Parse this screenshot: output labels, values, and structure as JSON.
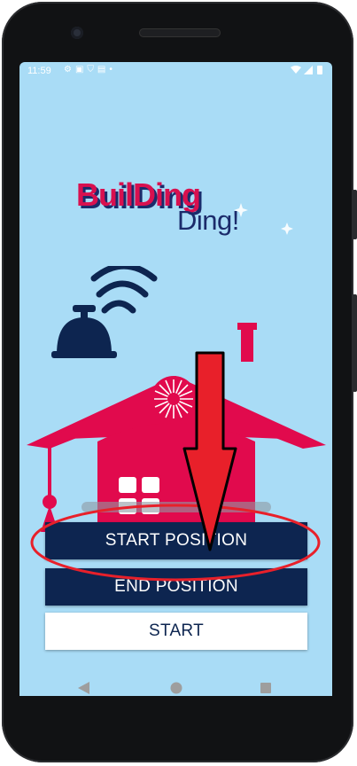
{
  "status_bar": {
    "time": "11:59",
    "left_icons": [
      "gear-icon",
      "media-icon",
      "shield-icon",
      "sim-icon",
      "dot-icon"
    ],
    "right_icons": [
      "wifi-icon",
      "signal-icon",
      "battery-icon"
    ]
  },
  "logo": {
    "word1": "BuilDing",
    "word2": "Ding!"
  },
  "buttons": {
    "start_position": "START POSITION",
    "end_position": "END POSITION",
    "start": "START"
  },
  "colors": {
    "screen_bg": "#a9dcf6",
    "primary_dark": "#0d2550",
    "accent_red": "#e10a4d",
    "annotation_red": "#e8202a"
  },
  "nav_bar": {
    "icons": [
      "back-icon",
      "home-icon",
      "recents-icon"
    ]
  }
}
